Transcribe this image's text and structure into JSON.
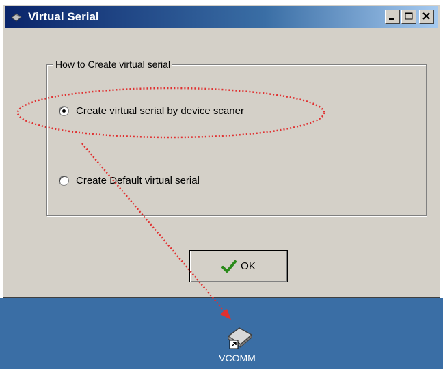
{
  "window": {
    "title": "Virtual Serial",
    "icon": "virtual-serial-icon"
  },
  "titlebar_buttons": {
    "minimize": "minimize-icon",
    "maximize": "maximize-icon",
    "close": "close-icon"
  },
  "group": {
    "title": "How to Create virtual serial",
    "options": [
      {
        "label": "Create virtual serial by device scaner",
        "checked": true
      },
      {
        "label": "Create Default virtual serial",
        "checked": false
      }
    ]
  },
  "ok_button": {
    "label": "OK",
    "icon": "checkmark-icon"
  },
  "desktop": {
    "background_color": "#3a6ea5",
    "shortcut": {
      "label": "VCOMM",
      "icon": "vcomm-shortcut-icon"
    }
  },
  "annotation": {
    "color": "#e03030"
  }
}
